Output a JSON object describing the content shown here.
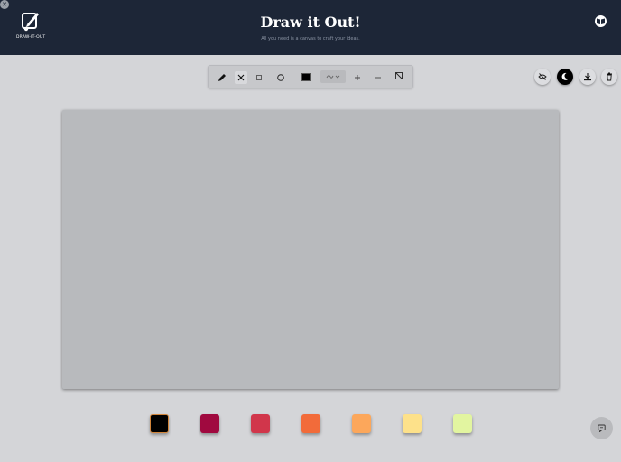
{
  "app": {
    "logo_text": "DRAW-IT-OUT",
    "title": "Draw it Out!",
    "subtitle": "All you need is a canvas to craft your ideas."
  },
  "header": {
    "close_icon": "close-icon",
    "guide_icon": "book-icon"
  },
  "toolbar": {
    "tools": [
      {
        "name": "pencil",
        "icon": "pencil-icon",
        "selected": false
      },
      {
        "name": "line",
        "icon": "line-icon",
        "selected": true
      },
      {
        "name": "rectangle",
        "icon": "square-icon",
        "selected": false
      },
      {
        "name": "circle",
        "icon": "circle-icon",
        "selected": false
      }
    ],
    "current_color": "#000000",
    "shape_select_icon": "shapes-icon",
    "zoom_in_icon": "plus-icon",
    "zoom_out_icon": "minus-icon",
    "clear_icon": "clear-canvas-icon"
  },
  "right_controls": [
    {
      "name": "toggle-visibility",
      "icon": "eye-off-icon"
    },
    {
      "name": "dark-mode",
      "icon": "moon-icon"
    },
    {
      "name": "download",
      "icon": "download-icon"
    },
    {
      "name": "delete",
      "icon": "trash-icon"
    }
  ],
  "palette": [
    {
      "color": "#000000",
      "active": true
    },
    {
      "color": "#a0093f",
      "active": false
    },
    {
      "color": "#d1364b",
      "active": false
    },
    {
      "color": "#f26b3a",
      "active": false
    },
    {
      "color": "#fca75b",
      "active": false
    },
    {
      "color": "#fde18a",
      "active": false
    },
    {
      "color": "#e2f5a0",
      "active": false
    }
  ],
  "colors": {
    "header_bg": "#1d2637",
    "page_bg": "#d4d5d8",
    "canvas_bg": "#b8babd"
  },
  "chat": {
    "icon": "chat-icon"
  }
}
